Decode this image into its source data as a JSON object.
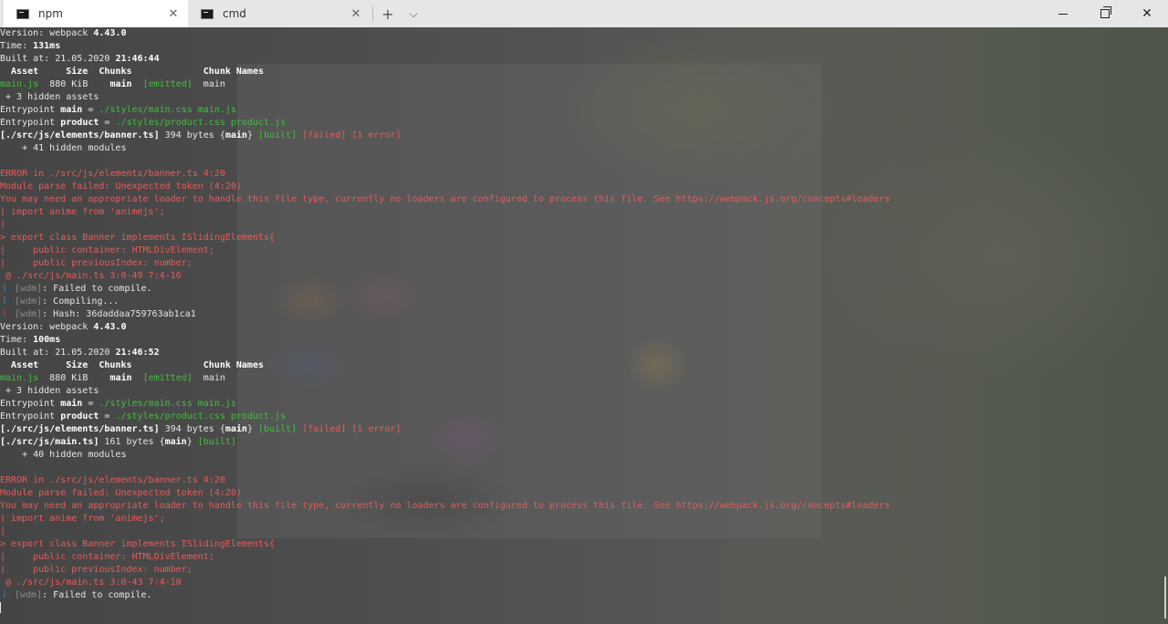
{
  "tabs": [
    {
      "label": "npm",
      "active": true
    },
    {
      "label": "cmd",
      "active": false
    }
  ],
  "tab_close_glyph": "✕",
  "new_tab_glyph": "+",
  "dropdown_glyph": "⌵",
  "window_close_glyph": "✕",
  "lines": [
    [
      {
        "t": "Version: webpack ",
        "c": "w"
      },
      {
        "t": "4.43.0",
        "c": "b"
      }
    ],
    [
      {
        "t": "Time: ",
        "c": "w"
      },
      {
        "t": "131ms",
        "c": "b"
      }
    ],
    [
      {
        "t": "Built at: 21.05.2020 ",
        "c": "w"
      },
      {
        "t": "21:46:44",
        "c": "b"
      }
    ],
    [
      {
        "t": "  Asset     Size  Chunks             Chunk Names",
        "c": "b"
      }
    ],
    [
      {
        "t": "main.js",
        "c": "g"
      },
      {
        "t": "  880 KiB    ",
        "c": "w"
      },
      {
        "t": "main",
        "c": "b"
      },
      {
        "t": "  ",
        "c": "w"
      },
      {
        "t": "[emitted]",
        "c": "g"
      },
      {
        "t": "  main",
        "c": "w"
      }
    ],
    [
      {
        "t": " + 3 hidden assets",
        "c": "w"
      }
    ],
    [
      {
        "t": "Entrypoint ",
        "c": "w"
      },
      {
        "t": "main",
        "c": "b"
      },
      {
        "t": " = ",
        "c": "w"
      },
      {
        "t": "./styles/main.css main.js",
        "c": "g"
      }
    ],
    [
      {
        "t": "Entrypoint ",
        "c": "w"
      },
      {
        "t": "product",
        "c": "b"
      },
      {
        "t": " = ",
        "c": "w"
      },
      {
        "t": "./styles/product.css product.js",
        "c": "g"
      }
    ],
    [
      {
        "t": "[./src/js/elements/banner.ts]",
        "c": "b"
      },
      {
        "t": " 394 bytes {",
        "c": "w"
      },
      {
        "t": "main",
        "c": "b"
      },
      {
        "t": "} ",
        "c": "w"
      },
      {
        "t": "[built]",
        "c": "g"
      },
      {
        "t": " ",
        "c": "w"
      },
      {
        "t": "[failed]",
        "c": "r"
      },
      {
        "t": " ",
        "c": "w"
      },
      {
        "t": "[1 error]",
        "c": "r"
      }
    ],
    [
      {
        "t": "    + 41 hidden modules",
        "c": "w"
      }
    ],
    [],
    [
      {
        "t": "ERROR in ./src/js/elements/banner.ts 4:20",
        "c": "r"
      }
    ],
    [
      {
        "t": "Module parse failed: Unexpected token (4:20)",
        "c": "r"
      }
    ],
    [
      {
        "t": "You may need an appropriate loader to handle this file type, currently no loaders are configured to process this file. See https://webpack.js.org/concepts#loaders",
        "c": "r"
      }
    ],
    [
      {
        "t": "| import anime from 'animejs';",
        "c": "r"
      }
    ],
    [
      {
        "t": "|",
        "c": "r"
      }
    ],
    [
      {
        "t": "> export class Banner implements ISlidingElements{",
        "c": "r"
      }
    ],
    [
      {
        "t": "|     public container: HTMLDivElement;",
        "c": "r"
      }
    ],
    [
      {
        "t": "|     public previousIndex: number;",
        "c": "r"
      }
    ],
    [
      {
        "t": " @ ./src/js/main.ts 3:0-49 7:4-16",
        "c": "r"
      }
    ],
    [
      {
        "t": "ｉ",
        "c": "cy"
      },
      {
        "t": " ",
        "c": "w"
      },
      {
        "t": "[wdm]",
        "c": "gr"
      },
      {
        "t": ": Failed to compile.",
        "c": "w"
      }
    ],
    [
      {
        "t": "ｉ",
        "c": "cy"
      },
      {
        "t": " ",
        "c": "w"
      },
      {
        "t": "[wdm]",
        "c": "gr"
      },
      {
        "t": ": Compiling...",
        "c": "w"
      }
    ],
    [
      {
        "t": "ｉ",
        "c": "rd"
      },
      {
        "t": " ",
        "c": "w"
      },
      {
        "t": "[wdm]",
        "c": "gr"
      },
      {
        "t": ": Hash: 36daddaa759763ab1ca1",
        "c": "w"
      }
    ],
    [
      {
        "t": "Version: webpack ",
        "c": "w"
      },
      {
        "t": "4.43.0",
        "c": "b"
      }
    ],
    [
      {
        "t": "Time: ",
        "c": "w"
      },
      {
        "t": "100ms",
        "c": "b"
      }
    ],
    [
      {
        "t": "Built at: 21.05.2020 ",
        "c": "w"
      },
      {
        "t": "21:46:52",
        "c": "b"
      }
    ],
    [
      {
        "t": "  Asset     Size  Chunks             Chunk Names",
        "c": "b"
      }
    ],
    [
      {
        "t": "main.js",
        "c": "g"
      },
      {
        "t": "  880 KiB    ",
        "c": "w"
      },
      {
        "t": "main",
        "c": "b"
      },
      {
        "t": "  ",
        "c": "w"
      },
      {
        "t": "[emitted]",
        "c": "g"
      },
      {
        "t": "  main",
        "c": "w"
      }
    ],
    [
      {
        "t": " + 3 hidden assets",
        "c": "w"
      }
    ],
    [
      {
        "t": "Entrypoint ",
        "c": "w"
      },
      {
        "t": "main",
        "c": "b"
      },
      {
        "t": " = ",
        "c": "w"
      },
      {
        "t": "./styles/main.css main.js",
        "c": "g"
      }
    ],
    [
      {
        "t": "Entrypoint ",
        "c": "w"
      },
      {
        "t": "product",
        "c": "b"
      },
      {
        "t": " = ",
        "c": "w"
      },
      {
        "t": "./styles/product.css product.js",
        "c": "g"
      }
    ],
    [
      {
        "t": "[./src/js/elements/banner.ts]",
        "c": "b"
      },
      {
        "t": " 394 bytes {",
        "c": "w"
      },
      {
        "t": "main",
        "c": "b"
      },
      {
        "t": "} ",
        "c": "w"
      },
      {
        "t": "[built]",
        "c": "g"
      },
      {
        "t": " ",
        "c": "w"
      },
      {
        "t": "[failed]",
        "c": "r"
      },
      {
        "t": " ",
        "c": "w"
      },
      {
        "t": "[1 error]",
        "c": "r"
      }
    ],
    [
      {
        "t": "[./src/js/main.ts]",
        "c": "b"
      },
      {
        "t": " 161 bytes {",
        "c": "w"
      },
      {
        "t": "main",
        "c": "b"
      },
      {
        "t": "} ",
        "c": "w"
      },
      {
        "t": "[built]",
        "c": "g"
      }
    ],
    [
      {
        "t": "    + 40 hidden modules",
        "c": "w"
      }
    ],
    [],
    [
      {
        "t": "ERROR in ./src/js/elements/banner.ts 4:20",
        "c": "r"
      }
    ],
    [
      {
        "t": "Module parse failed: Unexpected token (4:20)",
        "c": "r"
      }
    ],
    [
      {
        "t": "You may need an appropriate loader to handle this file type, currently no loaders are configured to process this file. See https://webpack.js.org/concepts#loaders",
        "c": "r"
      }
    ],
    [
      {
        "t": "| import anime from 'animejs';",
        "c": "r"
      }
    ],
    [
      {
        "t": "|",
        "c": "r"
      }
    ],
    [
      {
        "t": "> export class Banner implements ISlidingElements{",
        "c": "r"
      }
    ],
    [
      {
        "t": "|     public container: HTMLDivElement;",
        "c": "r"
      }
    ],
    [
      {
        "t": "|     public previousIndex: number;",
        "c": "r"
      }
    ],
    [
      {
        "t": " @ ./src/js/main.ts 3:0-43 7:4-10",
        "c": "r"
      }
    ],
    [
      {
        "t": "ｉ",
        "c": "cy"
      },
      {
        "t": " ",
        "c": "w"
      },
      {
        "t": "[wdm]",
        "c": "gr"
      },
      {
        "t": ": Failed to compile.",
        "c": "w"
      }
    ]
  ],
  "colors": {
    "text": "#e6e6e6",
    "green": "#3fbf3f",
    "red": "#e85a5a",
    "info": "#3a8fd0",
    "tabbar": "#e6e6e6"
  }
}
